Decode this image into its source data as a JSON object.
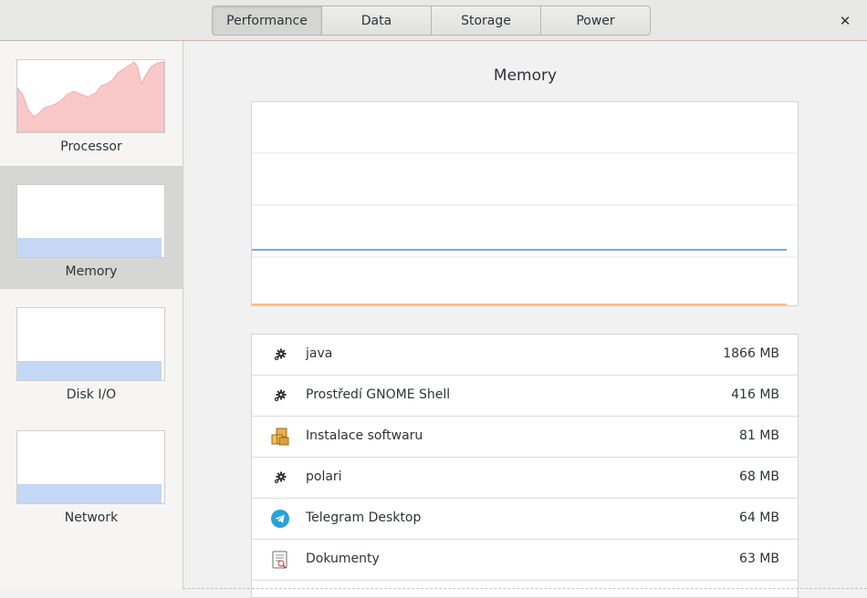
{
  "header": {
    "tabs": [
      {
        "label": "Performance",
        "active": true
      },
      {
        "label": "Data",
        "active": false
      },
      {
        "label": "Storage",
        "active": false
      },
      {
        "label": "Power",
        "active": false
      }
    ],
    "close_icon": "close-icon",
    "close_glyph": "✕"
  },
  "sidebar": {
    "items": [
      {
        "label": "Processor",
        "selected": false,
        "graph_color": "#f9c9c9",
        "graph_stroke": "#f3a9a9"
      },
      {
        "label": "Memory",
        "selected": true,
        "graph_color": "#c4d7f5",
        "level": 0.26
      },
      {
        "label": "Disk I/O",
        "selected": false,
        "graph_color": "#c4d7f5",
        "level": 0.26
      },
      {
        "label": "Network",
        "selected": false,
        "graph_color": "#c4d7f5",
        "level": 0.26
      }
    ]
  },
  "main": {
    "title": "Memory",
    "chart_data": {
      "type": "line",
      "series": [
        {
          "color": "#4a90d9",
          "level": 0.27
        },
        {
          "color": "#f5a85a",
          "level": 0.0
        }
      ],
      "grid": true
    },
    "processes": [
      {
        "name": "java",
        "memory": "1866 MB",
        "icon": "gear-icon"
      },
      {
        "name": "Prostředí GNOME Shell",
        "memory": "416 MB",
        "icon": "gear-icon"
      },
      {
        "name": "Instalace softwaru",
        "memory": "81 MB",
        "icon": "package-icon"
      },
      {
        "name": "polari",
        "memory": "68 MB",
        "icon": "gear-icon"
      },
      {
        "name": "Telegram Desktop",
        "memory": "64 MB",
        "icon": "telegram-icon"
      },
      {
        "name": "Dokumenty",
        "memory": "63 MB",
        "icon": "document-viewer-icon"
      }
    ]
  }
}
